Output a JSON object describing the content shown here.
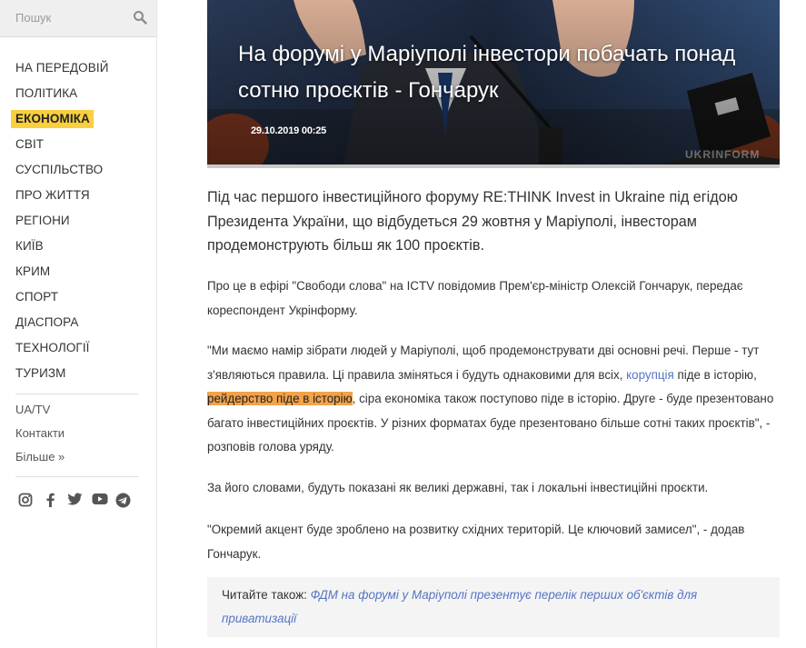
{
  "search": {
    "placeholder": "Пошук"
  },
  "nav": {
    "items": [
      {
        "label": "НА ПЕРЕДОВІЙ"
      },
      {
        "label": "ПОЛІТИКА"
      },
      {
        "label": "ЕКОНОМІКА"
      },
      {
        "label": "СВІТ"
      },
      {
        "label": "СУСПІЛЬСТВО"
      },
      {
        "label": "ПРО ЖИТТЯ"
      },
      {
        "label": "РЕГІОНИ"
      },
      {
        "label": "КИЇВ"
      },
      {
        "label": "КРИМ"
      },
      {
        "label": "СПОРТ"
      },
      {
        "label": "ДІАСПОРА"
      },
      {
        "label": "ТЕХНОЛОГІЇ"
      },
      {
        "label": "ТУРИЗМ"
      }
    ],
    "active_index": 2,
    "active_color": "#f8cf3d"
  },
  "secondary": {
    "uatv": "UA/TV",
    "contacts": "Контакти",
    "more": "Більше »"
  },
  "social": [
    "instagram-icon",
    "facebook-icon",
    "twitter-icon",
    "youtube-icon",
    "telegram-icon"
  ],
  "hero": {
    "title": "На форумі у Маріуполі інвестори побачать понад сотню проєктів - Гончарук",
    "date": "29.10.2019 00:25",
    "watermark": "UKRINFORM"
  },
  "article": {
    "lead": "Під час першого інвестиційного форуму RE:THINK Invest in Ukraine під егідою Президента України, що відбудеться 29 жовтня у Маріуполі, інвесторам продемонструють більш як 100 проєктів.",
    "p1": "Про це в ефірі \"Свободи слова\" на ICTV повідомив Прем'єр-міністр Олексій Гончарук, передає кореспондент Укрінформу.",
    "p2_a": "\"Ми маємо намір зібрати людей у Маріуполі, щоб продемонструвати дві основні речі. Перше - тут з'являються правила. Ці правила зміняться і будуть однаковими для всіх, ",
    "p2_link": "корупція",
    "p2_b": " піде в історію, ",
    "p2_highlight": "рейдерство піде в історію",
    "p2_c": ", сіра економіка також поступово піде в історію. Друге - буде презентовано багато інвестиційних проєктів. У різних форматах буде презентовано більше сотні таких проєктів\", - розповів голова уряду.",
    "p3": "За його словами, будуть показані як великі державні, так і локальні інвестиційні проєкти.",
    "p4": "\"Окремий акцент буде зроблено на розвитку східних територій. Це ключовий замисел\", - додав Гончарук.",
    "read_also_label": "Читайте також: ",
    "read_also_link": "ФДМ на форумі у Маріуполі презентує перелік перших об'єктів для приватизації"
  },
  "colors": {
    "link": "#5475c5",
    "highlight": "#f2a24a",
    "accent": "#f8cf3d"
  }
}
